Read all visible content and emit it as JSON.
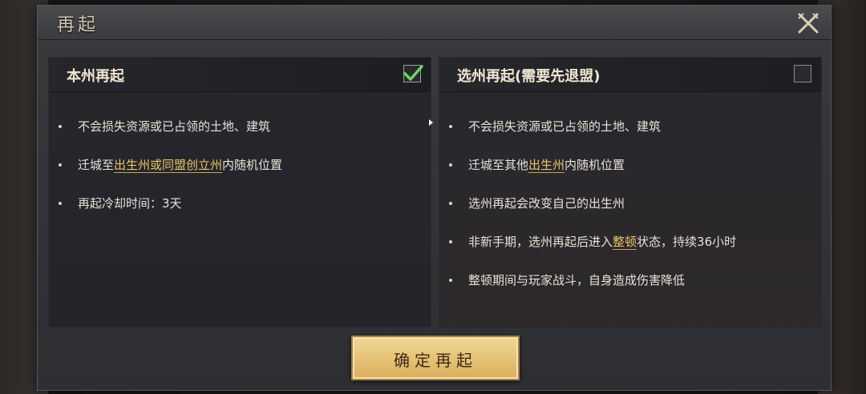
{
  "dialog": {
    "title": "再起",
    "close_icon": "close-crossed-swords-icon"
  },
  "left_panel": {
    "title": "本州再起",
    "checked": true,
    "bullets": [
      {
        "pre": "不会损失资源或已占领的土地、建筑",
        "hl": "",
        "post": ""
      },
      {
        "pre": "迁城至",
        "hl": "出生州或同盟创立州",
        "post": "内随机位置"
      },
      {
        "pre": "再起冷却时间：3天",
        "hl": "",
        "post": ""
      }
    ]
  },
  "right_panel": {
    "title": "选州再起(需要先退盟)",
    "checked": false,
    "bullets": [
      {
        "pre": "不会损失资源或已占领的土地、建筑",
        "hl": "",
        "post": ""
      },
      {
        "pre": "迁城至其他",
        "hl": "出生州",
        "post": "内随机位置"
      },
      {
        "pre": "选州再起会改变自己的出生州",
        "hl": "",
        "post": ""
      },
      {
        "pre": "非新手期，选州再起后进入",
        "hl": "整顿",
        "post": "状态，持续36小时"
      },
      {
        "pre": "整顿期间与玩家战斗，自身造成伤害降低",
        "hl": "",
        "post": ""
      }
    ]
  },
  "confirm_button": {
    "label": "确定再起"
  },
  "colors": {
    "highlight": "#e9c46a",
    "check": "#6fd16a",
    "button": "#e7c57a"
  }
}
